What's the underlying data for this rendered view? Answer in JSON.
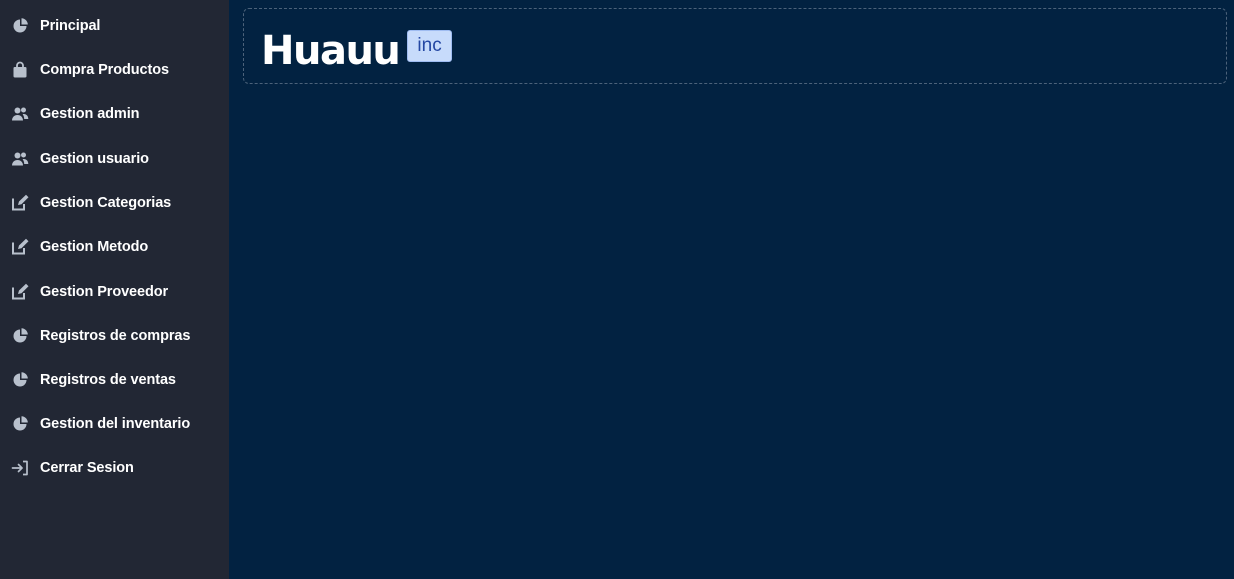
{
  "sidebar": {
    "items": [
      {
        "label": "Principal",
        "icon": "pie-chart-icon"
      },
      {
        "label": "Compra Productos",
        "icon": "shopping-bag-icon"
      },
      {
        "label": "Gestion admin",
        "icon": "users-icon"
      },
      {
        "label": "Gestion usuario",
        "icon": "users-icon"
      },
      {
        "label": "Gestion Categorias",
        "icon": "edit-icon"
      },
      {
        "label": "Gestion Metodo",
        "icon": "edit-icon"
      },
      {
        "label": "Gestion Proveedor",
        "icon": "edit-icon"
      },
      {
        "label": "Registros de compras",
        "icon": "pie-chart-icon"
      },
      {
        "label": "Registros de ventas",
        "icon": "pie-chart-icon"
      },
      {
        "label": "Gestion del inventario",
        "icon": "pie-chart-icon"
      },
      {
        "label": "Cerrar Sesion",
        "icon": "logout-icon"
      }
    ]
  },
  "header": {
    "brand": "Huauu",
    "badge": "inc"
  },
  "colors": {
    "sidebar_bg": "#222734",
    "main_bg": "#022241",
    "icon": "#b8c0cc",
    "badge_bg": "#c7dbfb",
    "badge_text": "#2447a3"
  }
}
